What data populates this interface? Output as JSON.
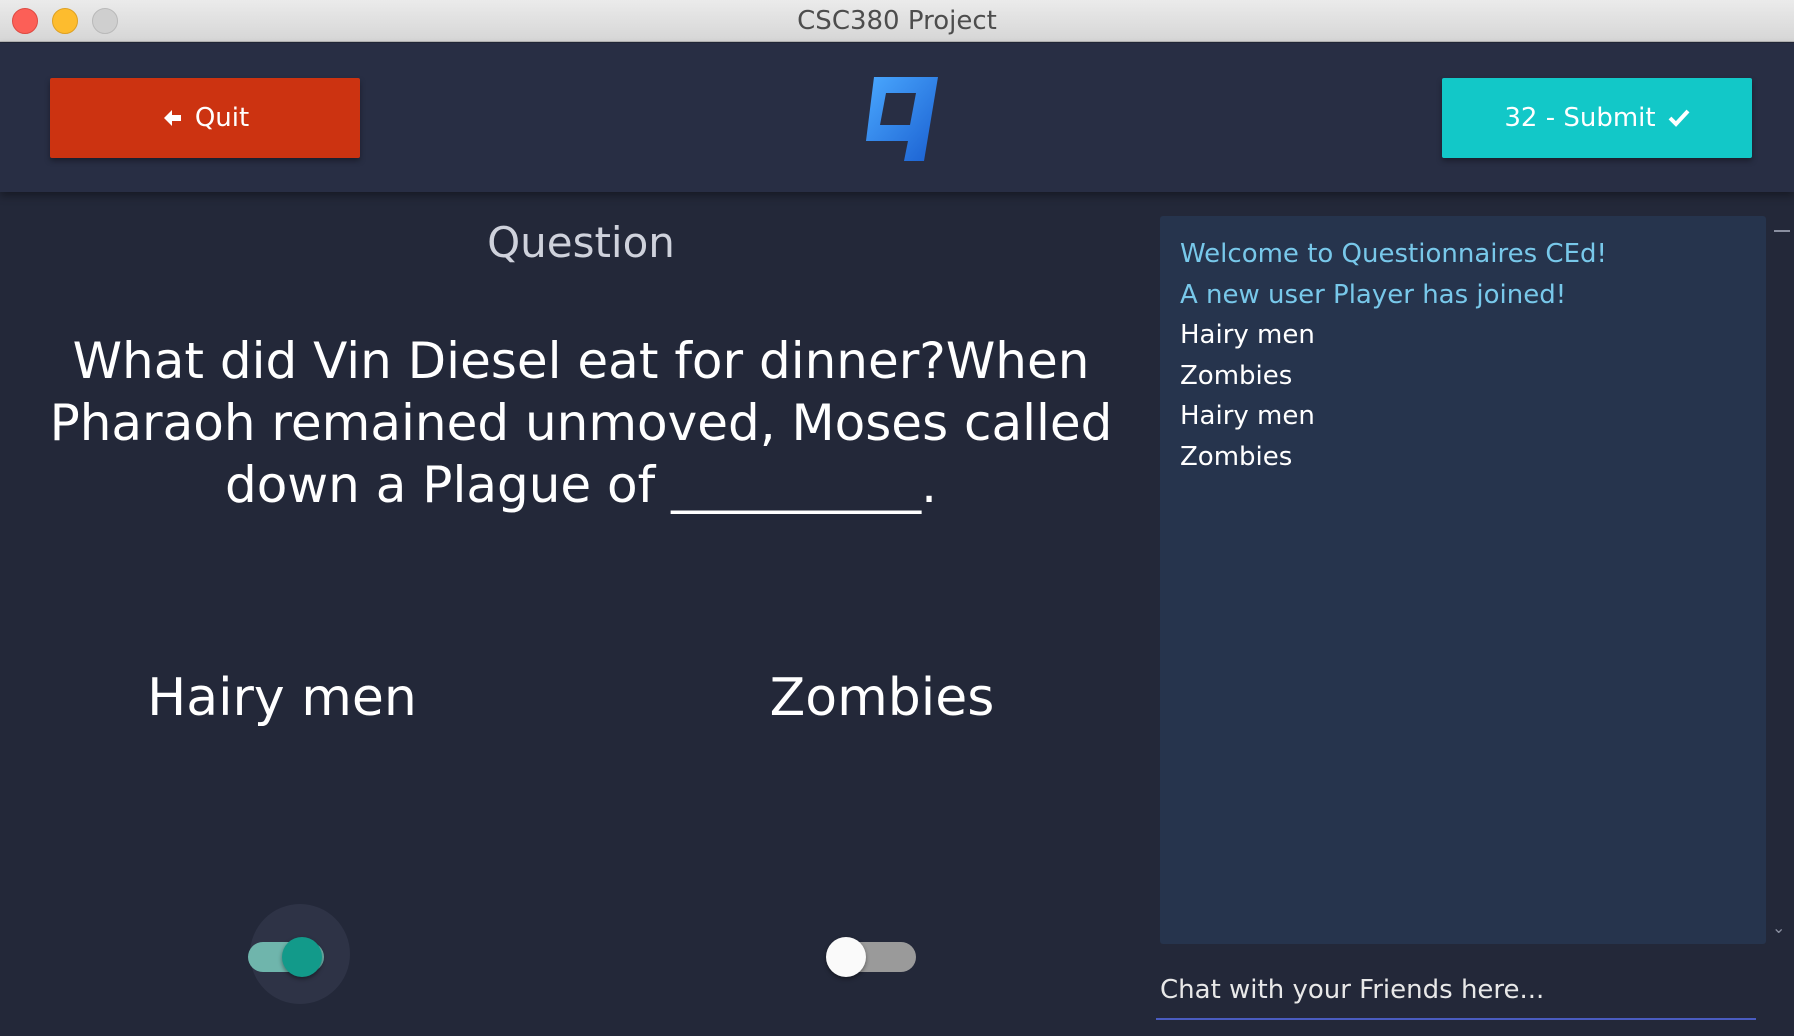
{
  "window": {
    "title": "CSC380 Project"
  },
  "header": {
    "quit_label": "Quit",
    "quit_icon": "arrow-left-icon",
    "submit_label": "32 - Submit",
    "submit_icon": "check-icon",
    "logo": "q-logo-icon"
  },
  "question": {
    "label": "Question",
    "text": "What did Vin Diesel eat for dinner?When Pharaoh remained unmoved, Moses called down a Plague of __________."
  },
  "answers": [
    {
      "label": "Hairy men",
      "selected": true
    },
    {
      "label": "Zombies",
      "selected": false
    }
  ],
  "chat": {
    "messages": [
      {
        "text": "Welcome to Questionnaires CEd!",
        "type": "system"
      },
      {
        "text": "A new user Player has joined!",
        "type": "system"
      },
      {
        "text": "Hairy men",
        "type": "user"
      },
      {
        "text": "Zombies",
        "type": "user"
      },
      {
        "text": "Hairy men",
        "type": "user"
      },
      {
        "text": "Zombies",
        "type": "user"
      }
    ],
    "input_placeholder": "Chat with your Friends here..."
  },
  "colors": {
    "background": "#232839",
    "header": "#282e44",
    "quit": "#cc3311",
    "submit": "#12c8c8",
    "chat_panel": "#26344d",
    "system_text": "#78c8ea",
    "toggle_on": "#129a8a"
  }
}
